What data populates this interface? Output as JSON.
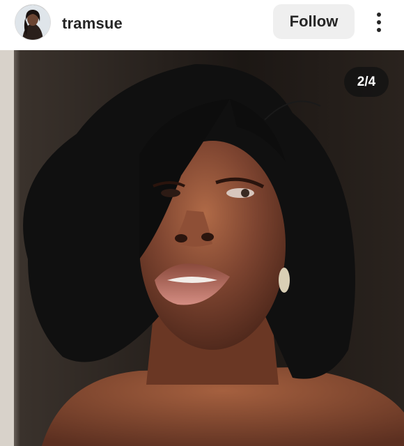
{
  "post_header": {
    "username": "tramsue",
    "follow_label": "Follow",
    "avatar_icon": "profile-avatar",
    "more_icon": "vertical-ellipsis-icon"
  },
  "media": {
    "counter": "2/4",
    "image_subject": "portrait-photo"
  },
  "colors": {
    "follow_button_bg": "#efefef",
    "text_primary": "#262626",
    "counter_bg": "#121212"
  }
}
